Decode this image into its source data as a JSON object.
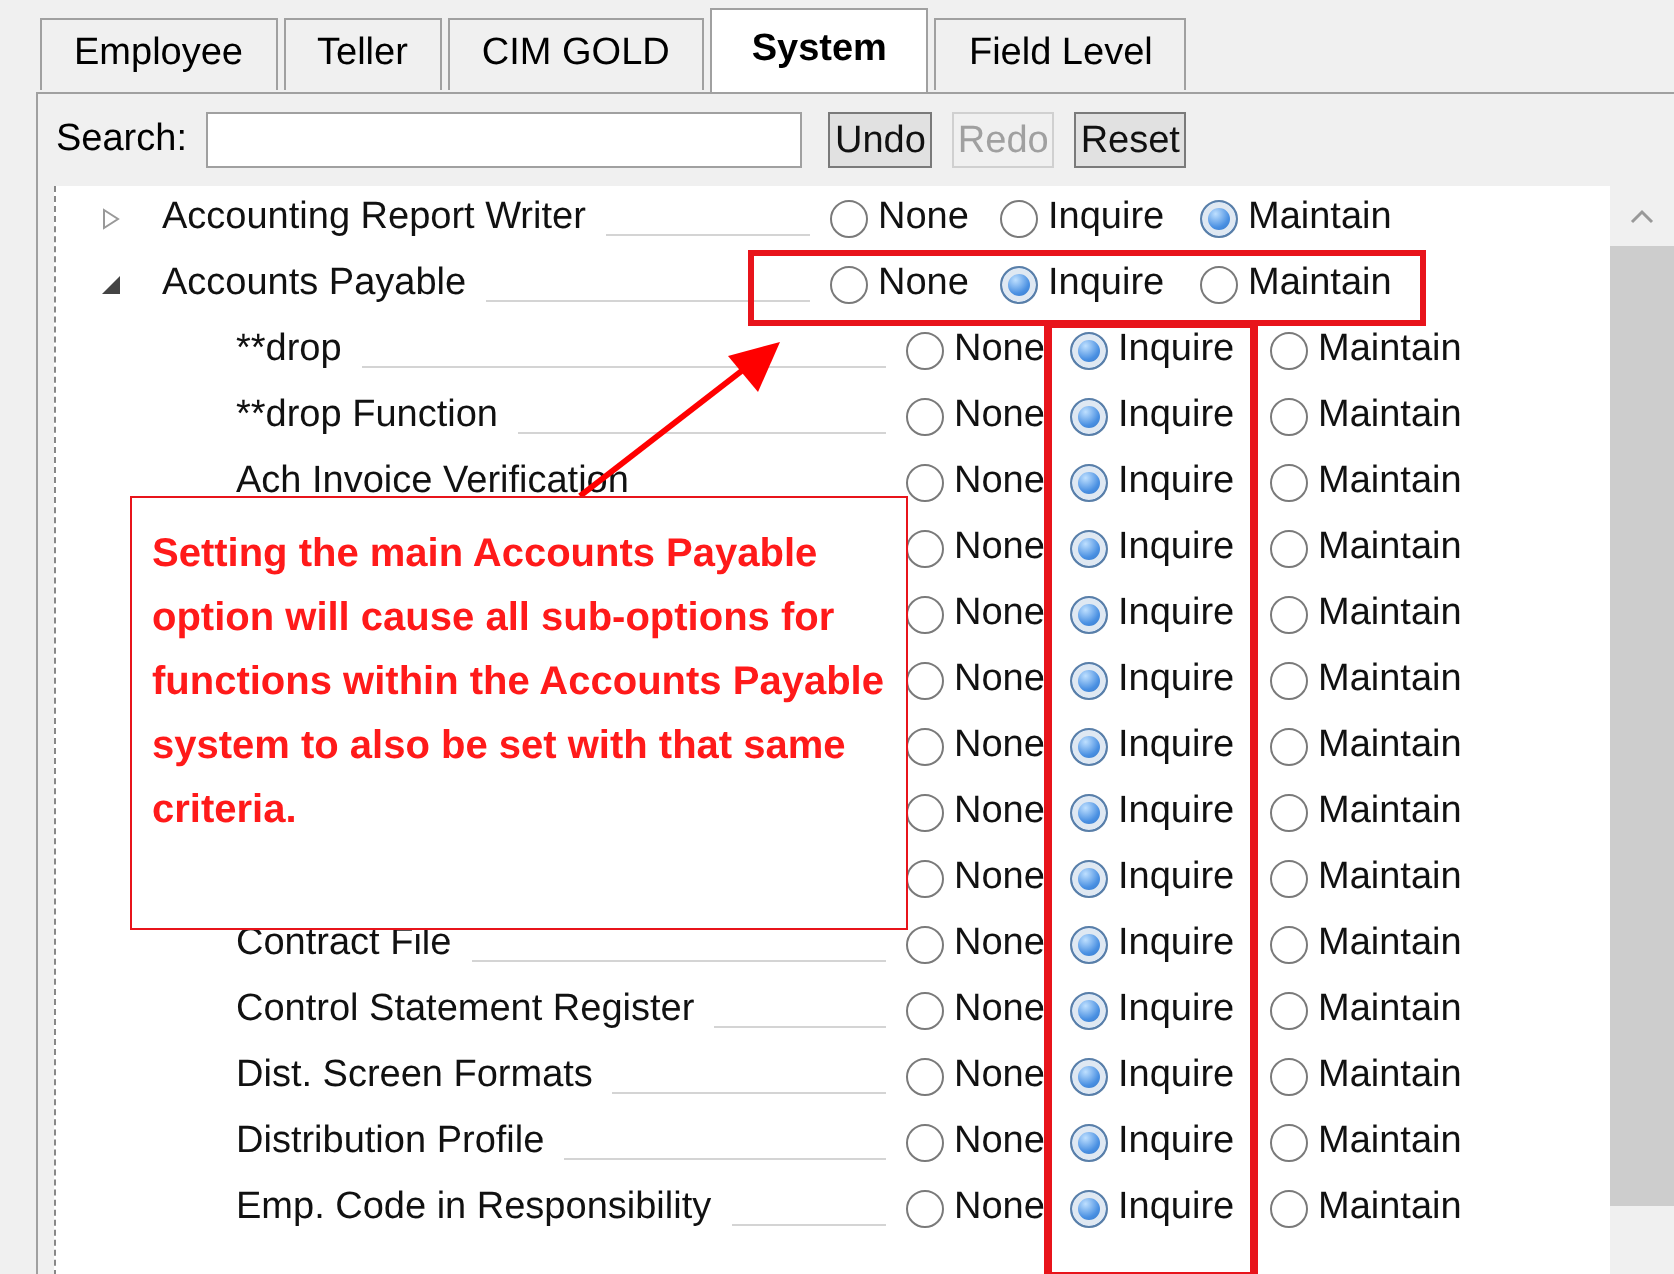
{
  "tabs": [
    {
      "label": "Employee",
      "selected": false
    },
    {
      "label": "Teller",
      "selected": false
    },
    {
      "label": "CIM GOLD",
      "selected": false
    },
    {
      "label": "System",
      "selected": true
    },
    {
      "label": "Field Level",
      "selected": false
    }
  ],
  "search": {
    "label": "Search:"
  },
  "buttons": [
    {
      "label": "Undo",
      "disabled": false
    },
    {
      "label": "Redo",
      "disabled": true
    },
    {
      "label": "Reset",
      "disabled": false
    }
  ],
  "tree": [
    {
      "name": "Accounting Report Writer",
      "expanded": false,
      "options": [
        {
          "label": "None",
          "selected": false
        },
        {
          "label": "Inquire",
          "selected": false
        },
        {
          "label": "Maintain",
          "selected": true
        }
      ]
    },
    {
      "name": "Accounts Payable",
      "expanded": true,
      "options": [
        {
          "label": "None",
          "selected": false
        },
        {
          "label": "Inquire",
          "selected": true
        },
        {
          "label": "Maintain",
          "selected": false
        }
      ],
      "children": [
        {
          "name": "**drop",
          "options": [
            {
              "label": "None",
              "selected": false
            },
            {
              "label": "Inquire",
              "selected": true
            },
            {
              "label": "Maintain",
              "selected": false
            }
          ]
        },
        {
          "name": "**drop Function",
          "options": [
            {
              "label": "None",
              "selected": false
            },
            {
              "label": "Inquire",
              "selected": true
            },
            {
              "label": "Maintain",
              "selected": false
            }
          ]
        },
        {
          "name": "Ach Invoice Verification",
          "options": [
            {
              "label": "None",
              "selected": false
            },
            {
              "label": "Inquire",
              "selected": true
            },
            {
              "label": "Maintain",
              "selected": false
            }
          ]
        },
        {
          "options": [
            {
              "label": "None",
              "selected": false
            },
            {
              "label": "Inquire",
              "selected": true
            },
            {
              "label": "Maintain",
              "selected": false
            }
          ]
        },
        {
          "options": [
            {
              "label": "None",
              "selected": false
            },
            {
              "label": "Inquire",
              "selected": true
            },
            {
              "label": "Maintain",
              "selected": false
            }
          ]
        },
        {
          "options": [
            {
              "label": "None",
              "selected": false
            },
            {
              "label": "Inquire",
              "selected": true
            },
            {
              "label": "Maintain",
              "selected": false
            }
          ]
        },
        {
          "options": [
            {
              "label": "None",
              "selected": false
            },
            {
              "label": "Inquire",
              "selected": true
            },
            {
              "label": "Maintain",
              "selected": false
            }
          ]
        },
        {
          "options": [
            {
              "label": "None",
              "selected": false
            },
            {
              "label": "Inquire",
              "selected": true
            },
            {
              "label": "Maintain",
              "selected": false
            }
          ]
        },
        {
          "options": [
            {
              "label": "None",
              "selected": false
            },
            {
              "label": "Inquire",
              "selected": true
            },
            {
              "label": "Maintain",
              "selected": false
            }
          ]
        },
        {
          "name": "Contract File",
          "options": [
            {
              "label": "None",
              "selected": false
            },
            {
              "label": "Inquire",
              "selected": true
            },
            {
              "label": "Maintain",
              "selected": false
            }
          ]
        },
        {
          "name": "Control Statement Register",
          "options": [
            {
              "label": "None",
              "selected": false
            },
            {
              "label": "Inquire",
              "selected": true
            },
            {
              "label": "Maintain",
              "selected": false
            }
          ]
        },
        {
          "name": "Dist. Screen Formats",
          "options": [
            {
              "label": "None",
              "selected": false
            },
            {
              "label": "Inquire",
              "selected": true
            },
            {
              "label": "Maintain",
              "selected": false
            }
          ]
        },
        {
          "name": "Distribution Profile",
          "options": [
            {
              "label": "None",
              "selected": false
            },
            {
              "label": "Inquire",
              "selected": true
            },
            {
              "label": "Maintain",
              "selected": false
            }
          ]
        },
        {
          "name": "Emp. Code in Responsibility",
          "options": [
            {
              "label": "None",
              "selected": false
            },
            {
              "label": "Inquire",
              "selected": true
            },
            {
              "label": "Maintain",
              "selected": false
            }
          ]
        }
      ]
    }
  ],
  "callout": {
    "text": "Setting the main Accounts Payable option will cause all sub-options for functions within the Accounts Payable system to also be set with that same criteria."
  }
}
